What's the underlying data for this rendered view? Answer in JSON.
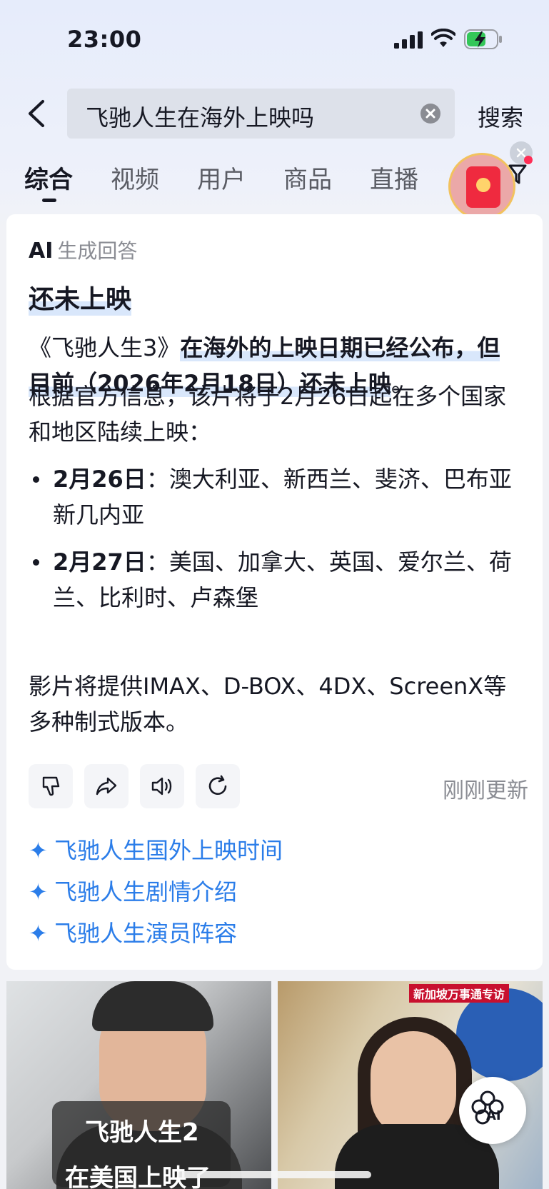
{
  "status_bar": {
    "time": "23:00"
  },
  "search": {
    "query": "飞驰人生在海外上映吗",
    "button_label": "搜索"
  },
  "tabs": [
    {
      "label": "综合",
      "active": true
    },
    {
      "label": "视频"
    },
    {
      "label": "用户"
    },
    {
      "label": "商品"
    },
    {
      "label": "直播"
    }
  ],
  "ai_card": {
    "header_ai": "AI",
    "header_label": "生成回答",
    "title": "还未上映",
    "p1_lead": "《飞驰人生3》",
    "p1_bold": "在海外的上映日期已经公布，但目前（2026年2月18日）还未上映",
    "p1_tail": "。",
    "p2": "根据官方信息，该片将于2月26日起在多个国家和地区陆续上映：",
    "bullets": [
      {
        "date": "2月26日",
        "sep": "：",
        "text": "澳大利亚、新西兰、斐济、巴布亚新几内亚"
      },
      {
        "date": "2月27日",
        "sep": "：",
        "text": "美国、加拿大、英国、爱尔兰、荷兰、比利时、卢森堡"
      }
    ],
    "p3": "影片将提供IMAX、D-BOX、4DX、ScreenX等多种制式版本。",
    "updated": "刚刚更新",
    "suggestions": [
      "飞驰人生国外上映时间",
      "飞驰人生剧情介绍",
      "飞驰人生演员阵容"
    ]
  },
  "videos": [
    {
      "caption_line1": "飞驰人生2",
      "caption_line2": "在美国上映了"
    },
    {
      "tag": "新加坡万事通专访"
    }
  ],
  "fab": {
    "label": "AI"
  },
  "colors": {
    "accent": "#2b7de9",
    "highlight": "#d9e7fb",
    "envelope": "#ef2a3f"
  }
}
